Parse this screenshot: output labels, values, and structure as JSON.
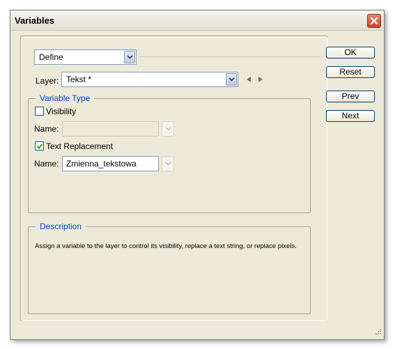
{
  "window": {
    "title": "Variables"
  },
  "define_combo": {
    "value": "Define"
  },
  "layer": {
    "label": "Layer:",
    "value": "Tekst *"
  },
  "variable_type": {
    "legend": "Variable Type",
    "visibility": {
      "label": "Visibility",
      "checked": false,
      "name_label": "Name:",
      "name_value": ""
    },
    "text_replacement": {
      "label": "Text Replacement",
      "checked": true,
      "name_label": "Name:",
      "name_value": "Zmienna_tekstowa"
    }
  },
  "description": {
    "legend": "Description",
    "text": "Assign a variable to the layer to control its visibility, replace a text string, or replace pixels."
  },
  "buttons": {
    "ok": "OK",
    "reset": "Reset",
    "prev": "Prev",
    "next": "Next"
  },
  "colors": {
    "legend_blue": "#0046d5",
    "close_red": "#c6462a",
    "dialog_bg": "#ece9d8"
  }
}
